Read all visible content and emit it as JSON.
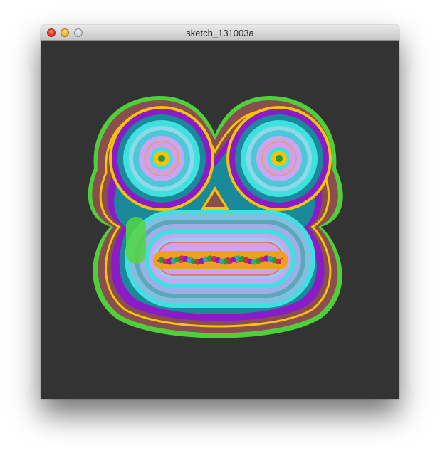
{
  "window": {
    "title": "sketch_131003a",
    "controls": {
      "close": "close-button",
      "minimize": "minimize-button",
      "zoom": "zoom-button"
    }
  },
  "canvas": {
    "background": "#333333",
    "palette": [
      "#55d640",
      "#8b4f4f",
      "#f6c20a",
      "#8a1cc8",
      "#1a8a9a",
      "#3ee0e0",
      "#c7a6f2",
      "#d3a0e8",
      "#e89a6a",
      "#2ea8a0",
      "#f0a020",
      "#c82a5a",
      "#2a9a3a"
    ]
  }
}
